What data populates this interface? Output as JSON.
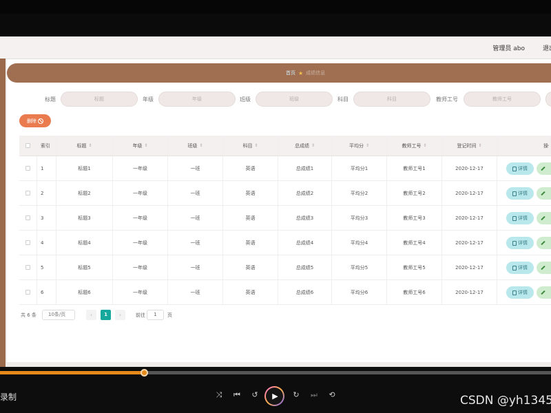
{
  "nav": {
    "user": "管理员 abo",
    "logout": "退出登录"
  },
  "breadcrumb": {
    "home": "首页",
    "current": "成绩信息"
  },
  "search": {
    "fields": [
      {
        "label": "标题",
        "placeholder": "标题"
      },
      {
        "label": "年级",
        "placeholder": "年级"
      },
      {
        "label": "班级",
        "placeholder": "班级"
      },
      {
        "label": "科目",
        "placeholder": "科目"
      },
      {
        "label": "教师工号",
        "placeholder": "教师工号"
      }
    ]
  },
  "toolbar": {
    "delete_label": "删除"
  },
  "table": {
    "headers": [
      "索引",
      "标题",
      "年级",
      "班级",
      "科目",
      "总成绩",
      "平均分",
      "教师工号",
      "登记时间",
      "操作"
    ],
    "rows": [
      {
        "index": "1",
        "title": "标题1",
        "grade": "一年级",
        "class": "一班",
        "subject": "英语",
        "total": "总成绩1",
        "avg": "平均分1",
        "teacher": "教师工号1",
        "date": "2020-12-17"
      },
      {
        "index": "2",
        "title": "标题2",
        "grade": "一年级",
        "class": "一班",
        "subject": "英语",
        "total": "总成绩2",
        "avg": "平均分2",
        "teacher": "教师工号2",
        "date": "2020-12-17"
      },
      {
        "index": "3",
        "title": "标题3",
        "grade": "一年级",
        "class": "一班",
        "subject": "英语",
        "total": "总成绩3",
        "avg": "平均分3",
        "teacher": "教师工号3",
        "date": "2020-12-17"
      },
      {
        "index": "4",
        "title": "标题4",
        "grade": "一年级",
        "class": "一班",
        "subject": "英语",
        "total": "总成绩4",
        "avg": "平均分4",
        "teacher": "教师工号4",
        "date": "2020-12-17"
      },
      {
        "index": "5",
        "title": "标题5",
        "grade": "一年级",
        "class": "一班",
        "subject": "英语",
        "total": "总成绩5",
        "avg": "平均分5",
        "teacher": "教师工号5",
        "date": "2020-12-17"
      },
      {
        "index": "6",
        "title": "标题6",
        "grade": "一年级",
        "class": "一班",
        "subject": "英语",
        "total": "总成绩6",
        "avg": "平均分6",
        "teacher": "教师工号6",
        "date": "2020-12-17"
      }
    ],
    "detail_label": "详情",
    "edit_label": "修改"
  },
  "pagination": {
    "total": "共 6 条",
    "page_size": "10条/页",
    "current": "1",
    "goto_label": "前往",
    "goto_value": "1",
    "unit": "页"
  },
  "player": {
    "record_label": "录制",
    "progress": 0.262,
    "watermark": "CSDN @yh1345"
  },
  "colors": {
    "accent": "#a06e50",
    "delete_button": "#ea7b4f",
    "page_active": "#16a89c",
    "detail_button": "#b8e8ec",
    "edit_button": "#cfeccf"
  }
}
